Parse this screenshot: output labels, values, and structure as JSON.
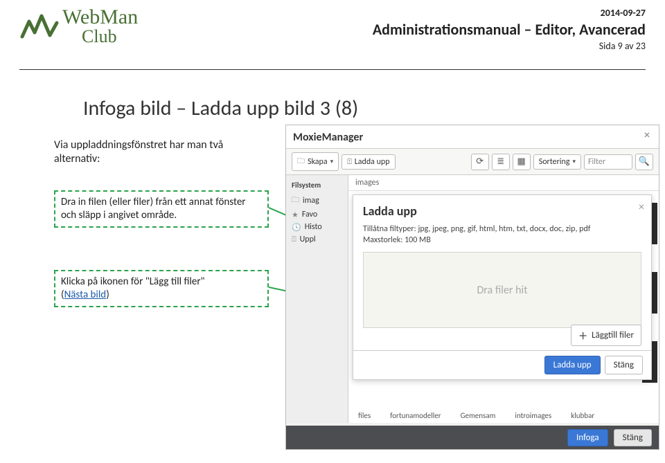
{
  "header": {
    "logo_line1": "WebMan",
    "logo_line2": "Club",
    "date": "2014-09-27",
    "manual_title": "Administrationsmanual – Editor, Avancerad",
    "page_label": "Sida 9 av 23"
  },
  "section": {
    "title": "Infoga bild – Ladda upp bild 3 (8)",
    "intro_line1": "Via uppladdningsfönstret har man två",
    "intro_line2": "alternativ:"
  },
  "callouts": {
    "c1_line1": "Dra in filen (eller filer) från ett annat fönster",
    "c1_line2": "och släpp i angivet område.",
    "c2_text": "Klicka på ikonen för \"Lägg till filer\"",
    "c2_link_pre": "(",
    "c2_link": "Nästa bild",
    "c2_link_post": ")"
  },
  "moxie": {
    "title": "MoxieManager",
    "toolbar": {
      "create": "Skapa",
      "upload": "Ladda upp",
      "sort": "Sortering",
      "filter_placeholder": "Filter"
    },
    "sidebar": {
      "heading": "Filsystem",
      "items": [
        {
          "label": "imag",
          "icon": "folder"
        },
        {
          "label": "Favo",
          "icon": "star"
        },
        {
          "label": "Histo",
          "icon": "clock"
        },
        {
          "label": "Uppl",
          "icon": "upload"
        }
      ]
    },
    "breadcrumb": "images",
    "upload": {
      "title": "Ladda upp",
      "allowed": "Tillåtna filtyper: jpg, jpeg, png, gif, html, htm, txt, docx, doc, zip, pdf",
      "maxsize": "Maxstorlek: 100 MB",
      "dropzone": "Dra filer hit",
      "add_files": "Läggtill filer",
      "do_upload": "Ladda upp",
      "close": "Stäng"
    },
    "thumb_labels": [
      "files",
      "fortunamodeller",
      "Gemensam",
      "introimages",
      "klubbar"
    ],
    "footer": {
      "insert": "Infoga",
      "close": "Stäng"
    }
  }
}
